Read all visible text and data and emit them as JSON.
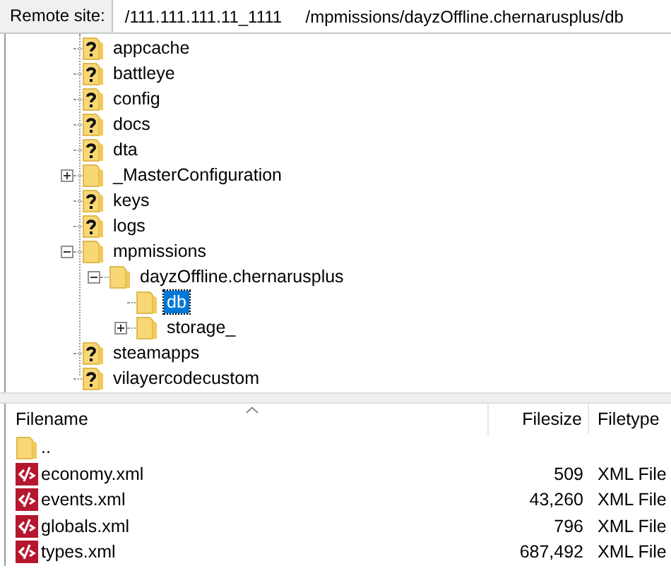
{
  "address_bar": {
    "label": "Remote site:",
    "value": "/111.111.111.11_1111     /mpmissions/dayzOffline.chernarusplus/db"
  },
  "tree": [
    {
      "name": "appcache",
      "kind": "unknown",
      "selected": false
    },
    {
      "name": "battleye",
      "kind": "unknown",
      "selected": false
    },
    {
      "name": "config",
      "kind": "unknown",
      "selected": false
    },
    {
      "name": "docs",
      "kind": "unknown",
      "selected": false
    },
    {
      "name": "dta",
      "kind": "unknown",
      "selected": false
    },
    {
      "name": "_MasterConfiguration",
      "kind": "folder",
      "selected": false,
      "expanded": false
    },
    {
      "name": "keys",
      "kind": "unknown",
      "selected": false
    },
    {
      "name": "logs",
      "kind": "unknown",
      "selected": false
    },
    {
      "name": "mpmissions",
      "kind": "folder",
      "selected": false,
      "expanded": true,
      "children": [
        {
          "name": "dayzOffline.chernarusplus",
          "kind": "folder",
          "selected": false,
          "expanded": true,
          "children": [
            {
              "name": "db",
              "kind": "folder",
              "selected": true
            },
            {
              "name": "storage_",
              "kind": "folder",
              "selected": false,
              "expanded": false
            }
          ]
        }
      ]
    },
    {
      "name": "steamapps",
      "kind": "unknown",
      "selected": false
    },
    {
      "name": "vilayercodecustom",
      "kind": "unknown",
      "selected": false
    }
  ],
  "file_list": {
    "columns": [
      "Filename",
      "Filesize",
      "Filetype"
    ],
    "rows": [
      {
        "name": "..",
        "kind": "folder"
      },
      {
        "name": "economy.xml",
        "kind": "xml",
        "size": "509",
        "type": "XML File"
      },
      {
        "name": "events.xml",
        "kind": "xml",
        "size": "43,260",
        "type": "XML File"
      },
      {
        "name": "globals.xml",
        "kind": "xml",
        "size": "796",
        "type": "XML File"
      },
      {
        "name": "types.xml",
        "kind": "xml",
        "size": "687,492",
        "type": "XML File"
      }
    ]
  }
}
